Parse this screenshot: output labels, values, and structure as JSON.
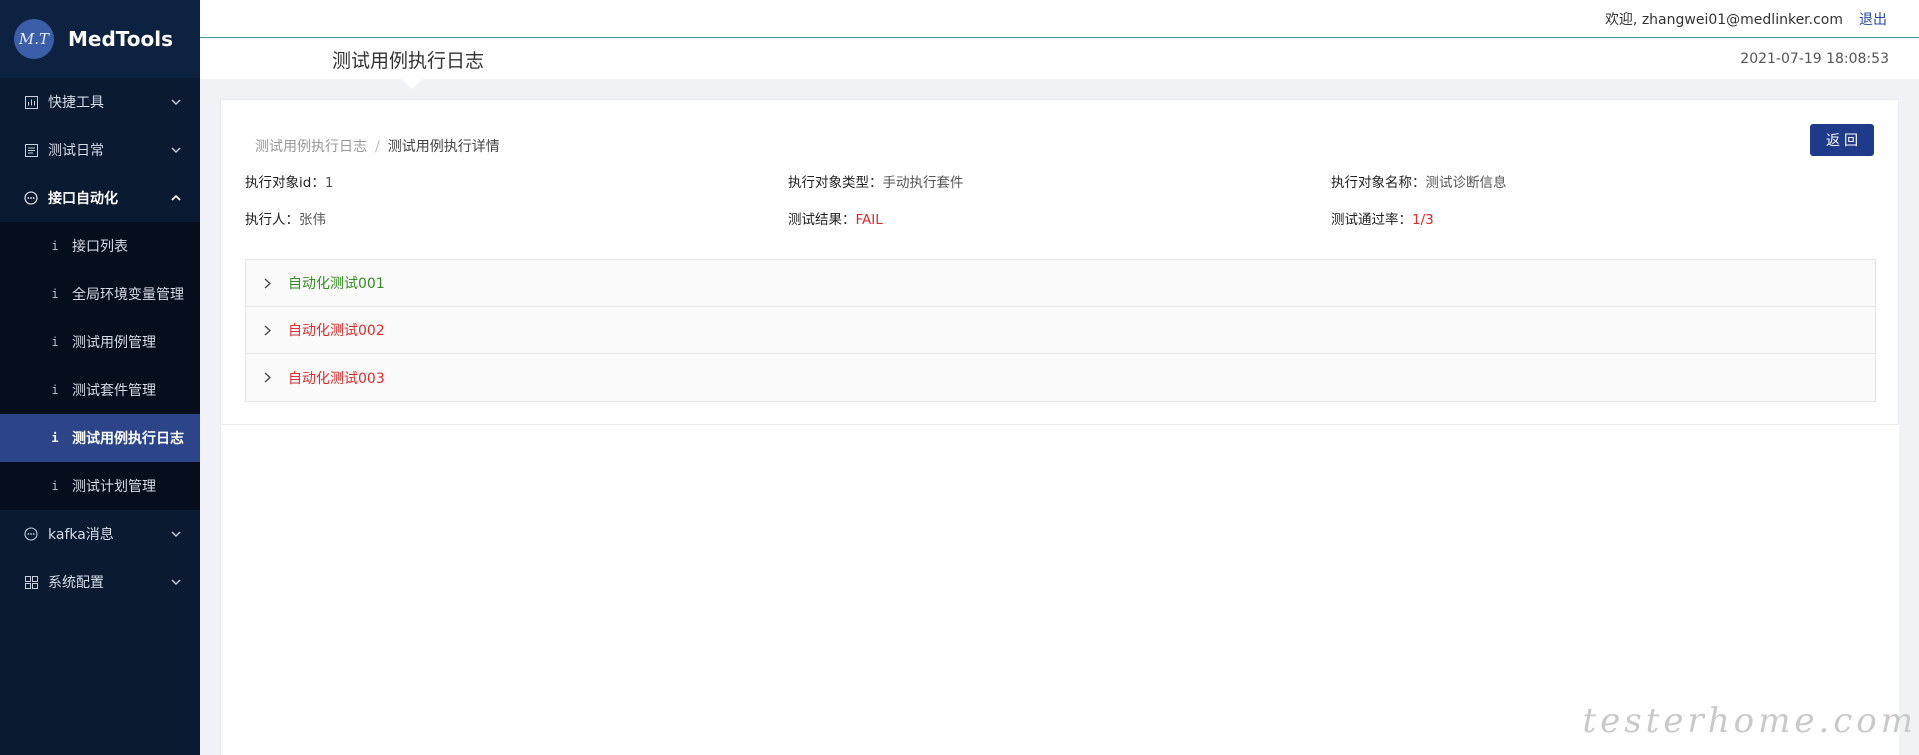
{
  "app": {
    "logo_initials": "M.T",
    "name": "MedTools"
  },
  "sidebar": {
    "items": [
      {
        "label": "快捷工具",
        "icon": "chart-icon",
        "expanded": false
      },
      {
        "label": "测试日常",
        "icon": "calendar-icon",
        "expanded": false
      },
      {
        "label": "接口自动化",
        "icon": "chat-icon",
        "expanded": true,
        "children": [
          {
            "label": "接口列表",
            "icon": "info-icon"
          },
          {
            "label": "全局环境变量管理",
            "icon": "info-icon"
          },
          {
            "label": "测试用例管理",
            "icon": "info-icon"
          },
          {
            "label": "测试套件管理",
            "icon": "info-icon"
          },
          {
            "label": "测试用例执行日志",
            "icon": "info-icon",
            "active": true
          },
          {
            "label": "测试计划管理",
            "icon": "info-icon"
          }
        ]
      },
      {
        "label": "kafka消息",
        "icon": "chat-icon",
        "expanded": false
      },
      {
        "label": "系统配置",
        "icon": "grid-icon",
        "expanded": false
      }
    ],
    "sub_icon_glyph": "i"
  },
  "header": {
    "welcome": "欢迎, zhangwei01@medlinker.com",
    "logout": "退出",
    "page_title": "测试用例执行日志",
    "datetime": "2021-07-19 18:08:53"
  },
  "main": {
    "breadcrumb": {
      "parent": "测试用例执行日志",
      "separator": "/",
      "current": "测试用例执行详情"
    },
    "back_button": "返回",
    "info": {
      "target_id_label": "执行对象id：",
      "target_id": "1",
      "target_type_label": "执行对象类型：",
      "target_type": "手动执行套件",
      "target_name_label": "执行对象名称：",
      "target_name": "测试诊断信息",
      "executor_label": "执行人：",
      "executor": "张伟",
      "result_label": "测试结果：",
      "result": "FAIL",
      "pass_rate_label": "测试通过率：",
      "pass_rate": "1/3"
    },
    "cases": [
      {
        "label": "自动化测试001",
        "status": "pass"
      },
      {
        "label": "自动化测试002",
        "status": "fail"
      },
      {
        "label": "自动化测试003",
        "status": "fail"
      }
    ]
  },
  "colors": {
    "sidebar_bg": "#0a1a30",
    "active_item": "#2c4589",
    "primary_button": "#1f3a8a",
    "pass": "#2f8f1f",
    "fail": "#e02b2b"
  },
  "watermark": "testerhome.com"
}
